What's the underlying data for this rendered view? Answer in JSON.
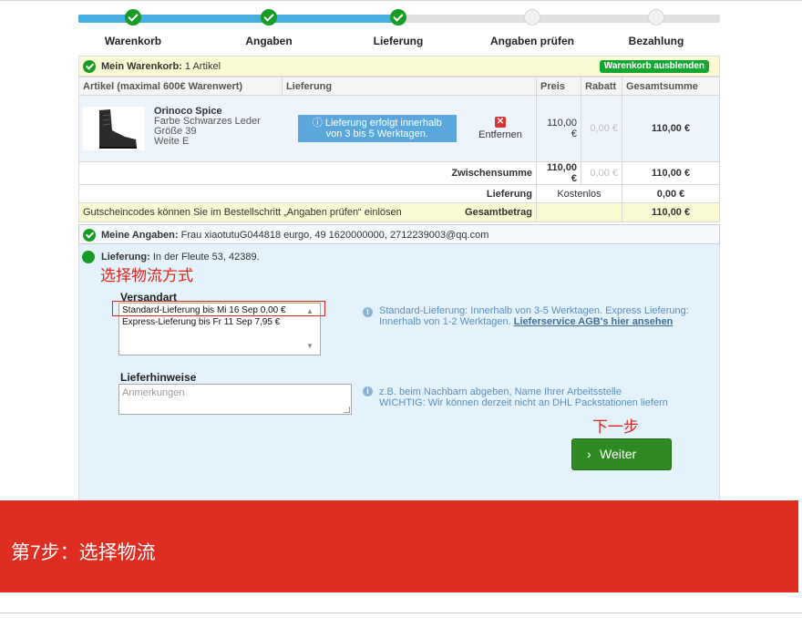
{
  "progress": {
    "steps": [
      {
        "label": "Warenkorb",
        "state": "done"
      },
      {
        "label": "Angaben",
        "state": "done"
      },
      {
        "label": "Lieferung",
        "state": "done"
      },
      {
        "label": "Angaben prüfen",
        "state": "todo"
      },
      {
        "label": "Bezahlung",
        "state": "todo"
      }
    ]
  },
  "cart": {
    "title": "Mein Warenkorb:",
    "count": "1 Artikel",
    "hide_button": "Warenkorb ausblenden",
    "columns": {
      "article": "Artikel (maximal 600€ Warenwert)",
      "delivery": "Lieferung",
      "price": "Preis",
      "discount": "Rabatt",
      "total": "Gesamtsumme"
    },
    "item": {
      "name": "Orinoco Spice",
      "color": "Farbe Schwarzes Leder",
      "size": "Größe 39",
      "width": "Weite E",
      "delivery_info_1": "Lieferung erfolgt innerhalb",
      "delivery_info_2": "von 3 bis 5 Werktagen.",
      "remove": "Entfernen",
      "price": "110,00 €",
      "discount": "0,00 €",
      "total": "110,00 €"
    },
    "subtotal": {
      "label": "Zwischensumme",
      "price": "110,00 €",
      "discount": "0,00 €",
      "total": "110,00 €"
    },
    "shipping": {
      "label": "Lieferung",
      "value": "Kostenlos",
      "total": "0,00 €"
    },
    "grand": {
      "note": "Gutscheincodes können Sie im Bestellschritt „Angaben prüfen“ einlösen",
      "label": "Gesamtbetrag",
      "total": "110,00 €"
    }
  },
  "my_data": {
    "title": "Meine Angaben:",
    "text": "Frau xiaotutuG044818 eurgo, 49 1620000000, 2712239003@qq.com"
  },
  "delivery": {
    "title": "Lieferung:",
    "address": "In der Fleute 53, 42389.",
    "annotation_select": "选择物流方式",
    "method_label": "Versandart",
    "options": [
      "Standard-Lieferung bis Mi 16 Sep 0,00 €",
      "Express-Lieferung bis Fr 11 Sep 7,95 €"
    ],
    "method_hint": "Standard-Lieferung: Innerhalb von 3-5 Werktagen. Express Lieferung: Innerhalb von 1-2 Werktagen.",
    "method_hint_link": "Lieferservice AGB's hier ansehen",
    "notes_label": "Lieferhinweise",
    "notes_placeholder": "Anmerkungen",
    "notes_hint_1": "z.B. beim Nachbarn abgeben, Name Ihrer Arbeitsstelle",
    "notes_hint_2": "WICHTIG: Wir können derzeit nicht an DHL Packstationen liefern",
    "annotation_next": "下一步",
    "next_button": "Weiter"
  },
  "banner": {
    "text": "第7步：选择物流"
  },
  "colors": {
    "accent_green": "#2f8a23",
    "banner_red": "#df2d22",
    "progress_blue": "#46aee0"
  }
}
